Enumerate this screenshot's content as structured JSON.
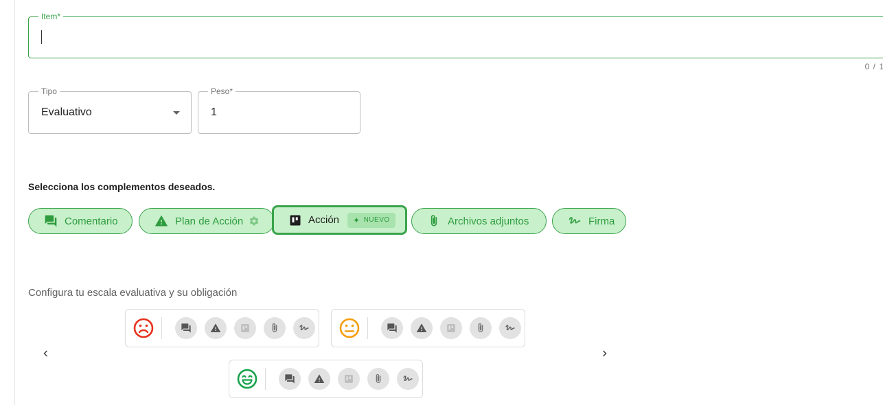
{
  "item_field": {
    "label": "Item*",
    "value": "",
    "counter": "0 / 1"
  },
  "tipo_field": {
    "label": "Tipo",
    "value": "Evaluativo"
  },
  "peso_field": {
    "label": "Peso*",
    "value": "1"
  },
  "complementos": {
    "title": "Selecciona los complementos deseados.",
    "chips": {
      "comentario": "Comentario",
      "plan": "Plan de Acción",
      "accion": "Acción",
      "accion_badge": "NUEVO",
      "archivos": "Archivos adjuntos",
      "firma": "Firma"
    }
  },
  "scale": {
    "title": "Configura tu escala evaluativa y su obligación",
    "colors": {
      "bad": "#e5311c",
      "mid": "#f59e0b",
      "good": "#16a34a",
      "accent": "#3aa34a"
    }
  },
  "icons": [
    "comment-icon",
    "warning-icon",
    "action-board-icon",
    "attachment-icon",
    "signature-icon",
    "settings-icon",
    "sparkle-icon",
    "chevron-left-icon",
    "chevron-right-icon",
    "dropdown-arrow-icon"
  ]
}
